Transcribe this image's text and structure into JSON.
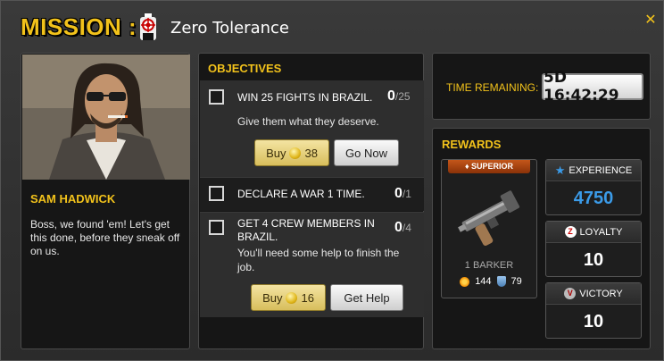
{
  "title": {
    "mission_label": "MISSION :",
    "mission_name": "Zero Tolerance",
    "close_icon": "close-icon"
  },
  "character": {
    "name": "SAM HADWICK",
    "quote": "Boss, we found 'em! Let's get this done, before they sneak off on us."
  },
  "objectives": {
    "header": "OBJECTIVES",
    "items": [
      {
        "title": "WIN 25 FIGHTS IN BRAZIL.",
        "progress": "0",
        "total": "/25",
        "description": "Give them what they deserve.",
        "buy_cost": "38",
        "buy_label": "Buy",
        "action_label": "Go Now"
      },
      {
        "title": "DECLARE A WAR 1 TIME.",
        "progress": "0",
        "total": "/1"
      },
      {
        "title": "GET 4 CREW MEMBERS IN BRAZIL.",
        "progress": "0",
        "total": "/4",
        "description": "You'll need some help to finish the job.",
        "buy_cost": "16",
        "buy_label": "Buy",
        "action_label": "Get Help"
      }
    ]
  },
  "timer": {
    "label": "TIME REMAINING:",
    "value": "5D 16:42:29"
  },
  "rewards": {
    "header": "REWARDS",
    "item": {
      "rarity": "SUPERIOR",
      "name": "1 BARKER",
      "attack": "144",
      "defense": "79"
    },
    "experience": {
      "label": "EXPERIENCE",
      "value": "4750",
      "color": "#3b9be8"
    },
    "loyalty": {
      "label": "LOYALTY",
      "value": "10"
    },
    "victory": {
      "label": "VICTORY",
      "value": "10"
    }
  },
  "colors": {
    "accent": "#f2c21b",
    "experience": "#3b9be8"
  }
}
